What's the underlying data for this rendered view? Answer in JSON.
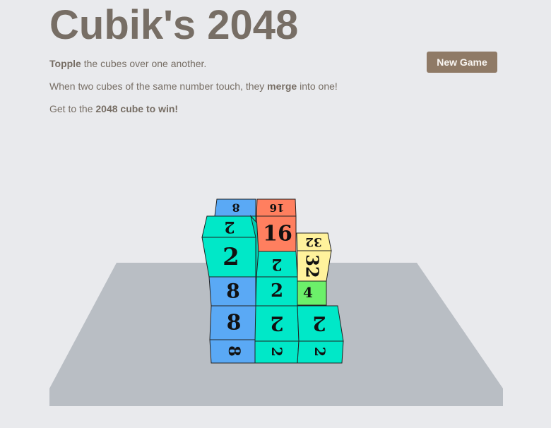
{
  "header": {
    "title": "Cubik's 2048",
    "new_game_label": "New Game"
  },
  "instructions": {
    "line1_bold": "Topple",
    "line1_rest": " the cubes over one another.",
    "line2_start": "When two cubes of the same number touch, they ",
    "line2_bold": "merge",
    "line2_end": " into one!",
    "line3_start": "Get to the ",
    "line3_bold": "2048 cube to win!"
  },
  "colors": {
    "background": "#e9eaed",
    "text": "#776e65",
    "button": "#8f7a66",
    "board": "#b9bec4",
    "cube_2": "#00e8c8",
    "cube_4": "#6cf06a",
    "cube_8": "#5aa9f5",
    "cube_16": "#ff7f5f",
    "cube_32": "#fff29c"
  },
  "cubes": [
    {
      "id": "cube-back-left-top",
      "value": "8",
      "color": "#5aa9f5"
    },
    {
      "id": "cube-back-middle-top",
      "value": "16",
      "color": "#ff7f5f"
    },
    {
      "id": "cube-middle-left",
      "value": "2",
      "color": "#00e8c8"
    },
    {
      "id": "cube-middle-left-front",
      "value": "8",
      "color": "#5aa9f5"
    },
    {
      "id": "cube-middle-center",
      "value": "2",
      "color": "#00e8c8"
    },
    {
      "id": "cube-right-top",
      "value": "32",
      "color": "#fff29c"
    },
    {
      "id": "cube-right-small",
      "value": "4",
      "color": "#6cf06a"
    },
    {
      "id": "cube-front-left",
      "value": "8",
      "color": "#5aa9f5"
    },
    {
      "id": "cube-front-center",
      "value": "2",
      "color": "#00e8c8"
    },
    {
      "id": "cube-front-right",
      "value": "2",
      "color": "#00e8c8"
    }
  ]
}
